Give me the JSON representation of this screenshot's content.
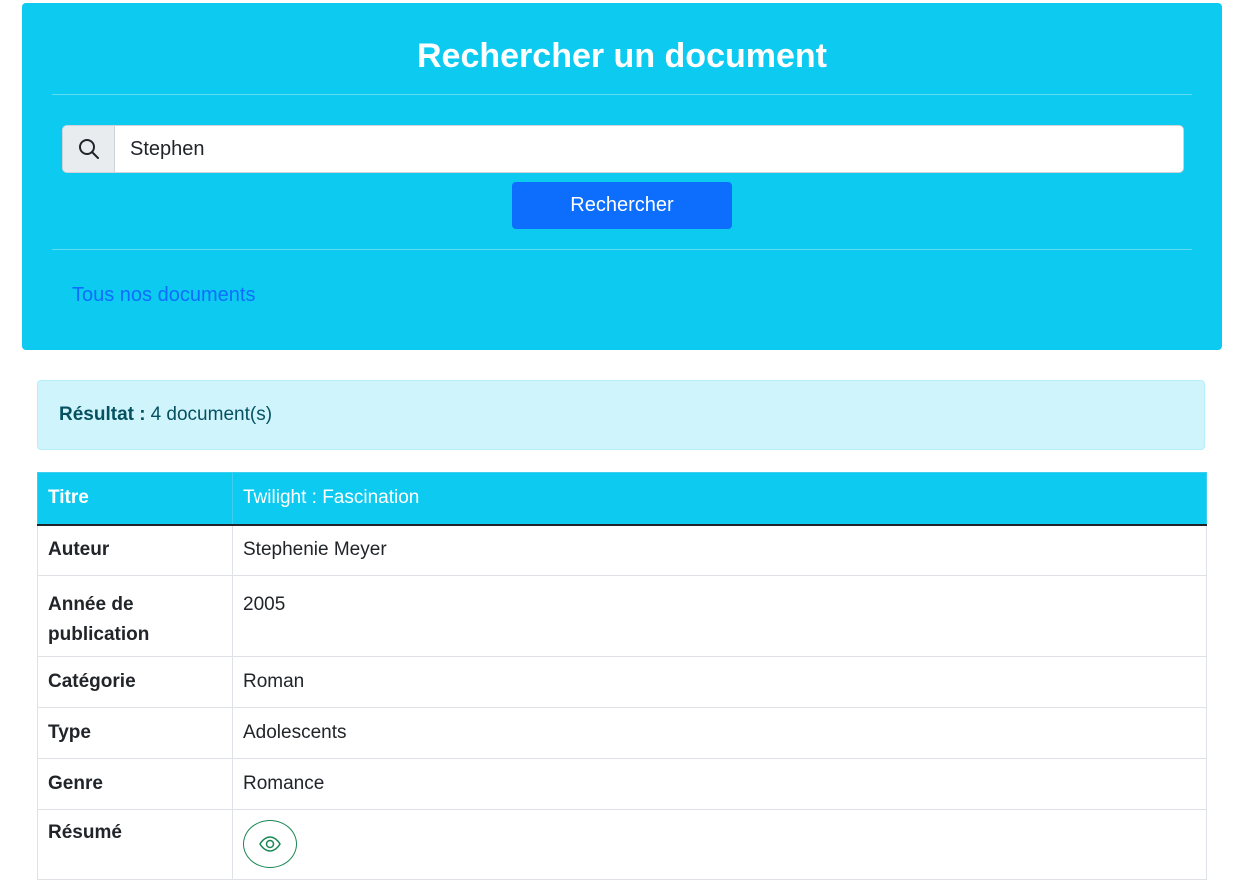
{
  "header": {
    "title": "Rechercher un document"
  },
  "search": {
    "value": "Stephen",
    "icon": "search-icon",
    "button_label": "Rechercher"
  },
  "links": {
    "all_documents": "Tous nos documents"
  },
  "result": {
    "label": "Résultat :",
    "count_text": "4 document(s)"
  },
  "document": {
    "titre_label": "Titre",
    "titre_value": "Twilight : Fascination",
    "auteur_label": "Auteur",
    "auteur_value": "Stephenie Meyer",
    "annee_label": "Année de publication",
    "annee_value": "2005",
    "categorie_label": "Catégorie",
    "categorie_value": "Roman",
    "type_label": "Type",
    "type_value": "Adolescents",
    "genre_label": "Genre",
    "genre_value": "Romance",
    "resume_label": "Résumé",
    "resume_icon": "eye-icon"
  },
  "colors": {
    "header_bg": "#0dcaf0",
    "primary": "#0d6efd",
    "alert_bg": "#cff4fc",
    "alert_text": "#055160",
    "success": "#198754"
  }
}
